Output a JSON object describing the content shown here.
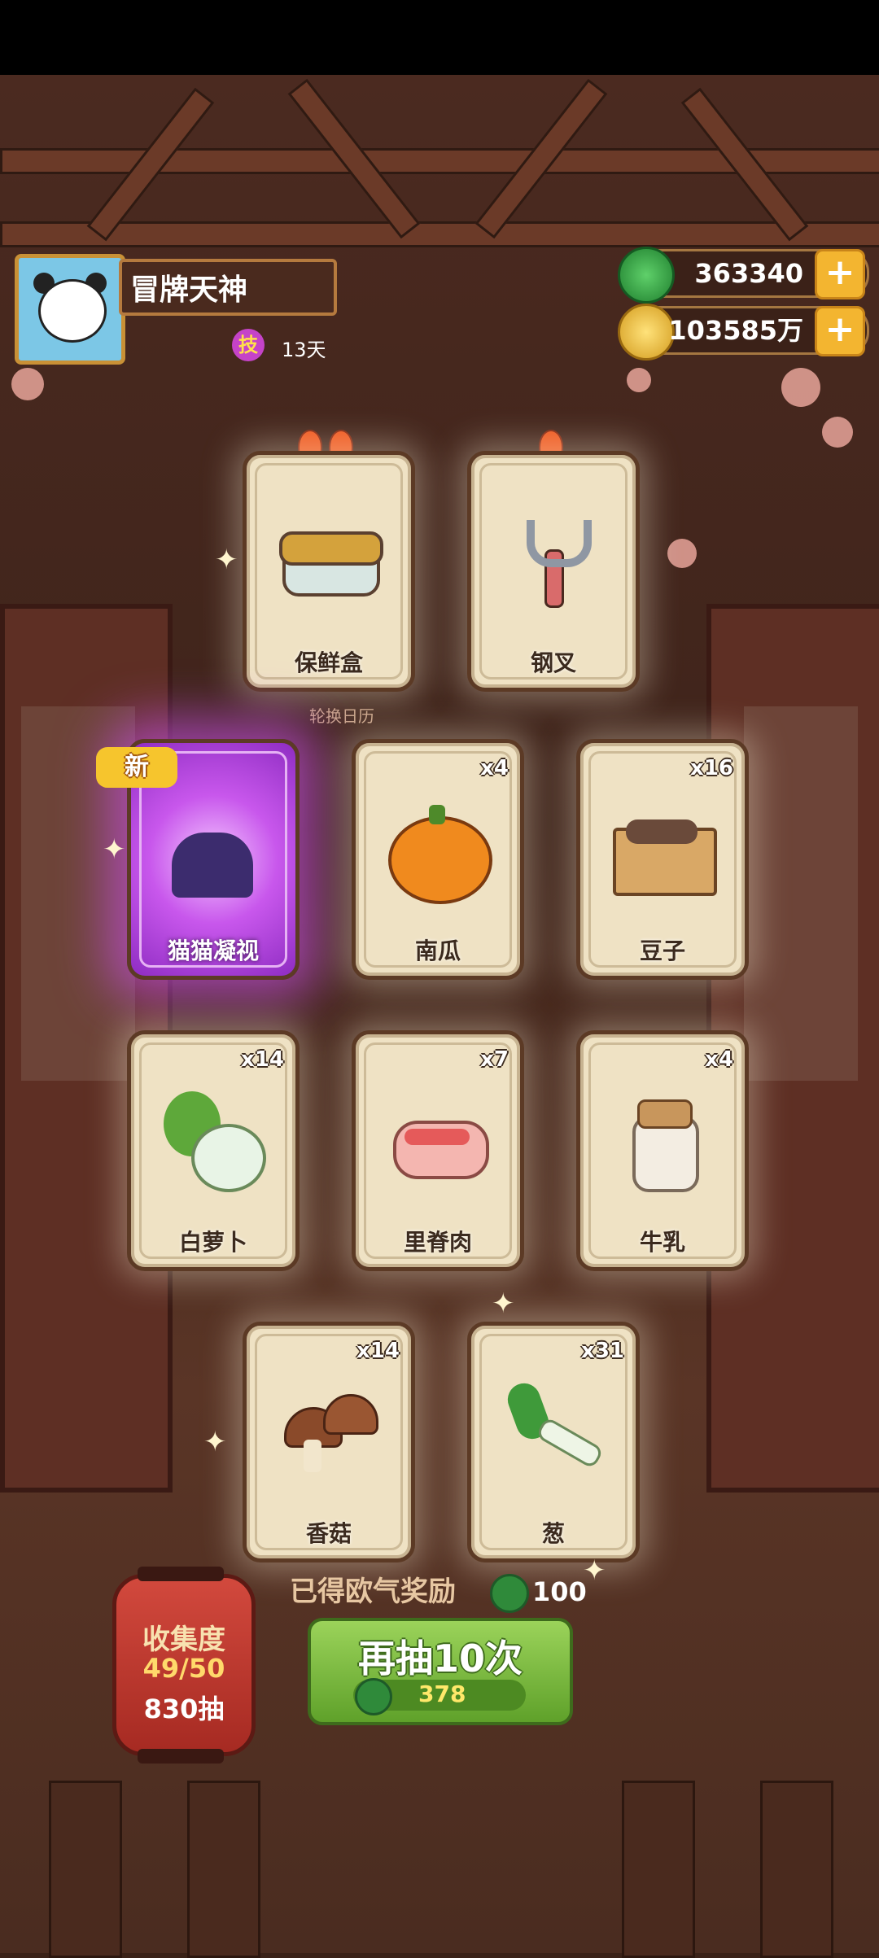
{
  "player": {
    "name": "冒牌天神",
    "skill_badge": "技",
    "skill_days": "13天"
  },
  "currency": {
    "jade": "363340",
    "coins": "103585万",
    "plus_symbol": "+"
  },
  "calendar_label": "轮换日历",
  "new_badge": "新",
  "cards": [
    {
      "label": "保鲜盒",
      "count": ""
    },
    {
      "label": "钢叉",
      "count": ""
    },
    {
      "label": "猫猫凝视",
      "count": ""
    },
    {
      "label": "南瓜",
      "count": "x4"
    },
    {
      "label": "豆子",
      "count": "x16"
    },
    {
      "label": "白萝卜",
      "count": "x14"
    },
    {
      "label": "里脊肉",
      "count": "x7"
    },
    {
      "label": "牛乳",
      "count": "x4"
    },
    {
      "label": "香菇",
      "count": "x14"
    },
    {
      "label": "葱",
      "count": "x31"
    }
  ],
  "reward": {
    "text": "已得欧气奖励",
    "value": "100"
  },
  "draw_button": {
    "title": "再抽10次",
    "cost": "378"
  },
  "collection": {
    "label": "收集度",
    "progress": "49/50",
    "draws": "830抽"
  },
  "colors": {
    "rare_glow": "#c857ec",
    "button_green": "#5fa12a",
    "gold": "#f3b530"
  }
}
